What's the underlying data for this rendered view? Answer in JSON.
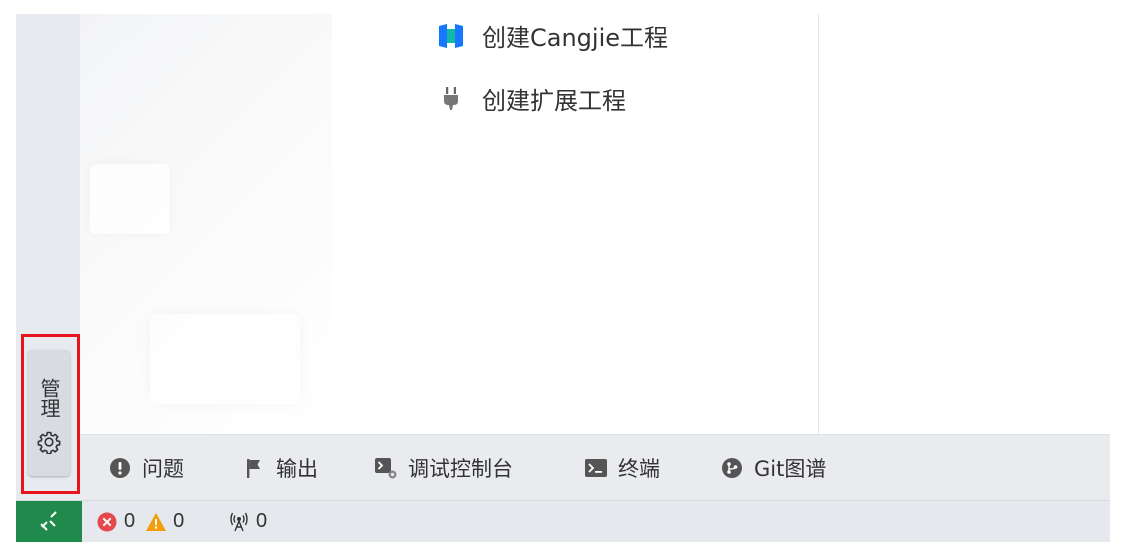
{
  "activity_bar": {
    "manage_label": "管理"
  },
  "welcome": {
    "items": [
      {
        "label": "创建Cangjie工程",
        "icon": "cangjie-project-icon"
      },
      {
        "label": "创建扩展工程",
        "icon": "plug-icon"
      }
    ]
  },
  "panel": {
    "tabs": [
      {
        "label": "问题",
        "icon": "problems-icon"
      },
      {
        "label": "输出",
        "icon": "flag-icon"
      },
      {
        "label": "调试控制台",
        "icon": "debug-console-icon"
      },
      {
        "label": "终端",
        "icon": "terminal-icon"
      },
      {
        "label": "Git图谱",
        "icon": "git-graph-icon"
      }
    ]
  },
  "status_bar": {
    "remote_icon": "remote-icon",
    "errors": "0",
    "warnings": "0",
    "ports": "0"
  },
  "colors": {
    "highlight": "#e8141c",
    "remote_bg": "#1f8a4c",
    "error": "#e5484d",
    "warning": "#f29d0a",
    "cangjie_blue": "#1677ff",
    "cangjie_teal": "#14b8a6"
  }
}
